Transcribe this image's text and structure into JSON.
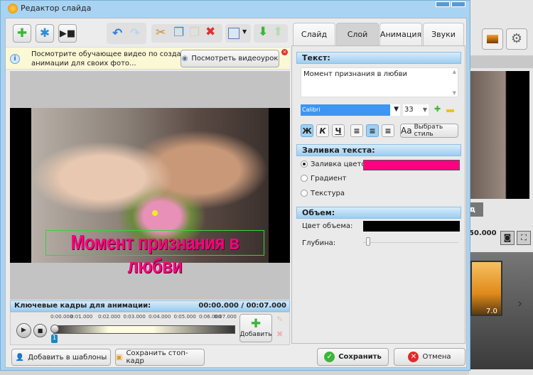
{
  "window": {
    "title": "Редактор слайда"
  },
  "info": {
    "message_line1": "Посмотрите обучающее видео по созданию",
    "message_line2": "анимации для своих фото...",
    "watch_button": "Посмотреть видеоурок"
  },
  "slide": {
    "overlay_text": "Момент признания в любви"
  },
  "keyframes": {
    "title": "Ключевые кадры для анимации:",
    "time": "00:00.000 / 00:07.000",
    "ticks": [
      "0:00.000",
      "0:01.000",
      "0:02.000",
      "0:03.000",
      "0:04.000",
      "0:05.000",
      "0:06.000",
      "0:07.000"
    ],
    "marker": "1",
    "add_label": "Добавить"
  },
  "bottom": {
    "add_template": "Добавить в шаблоны",
    "save_frame": "Сохранить стоп-кадр",
    "save": "Сохранить",
    "cancel": "Отмена"
  },
  "tabs": [
    {
      "label": "Слайд"
    },
    {
      "label": "Слой"
    },
    {
      "label": "Анимация"
    },
    {
      "label": "Звуки"
    }
  ],
  "panel": {
    "text_section": "Текст:",
    "text_value": "Момент признания в любви",
    "font": "Calibri",
    "size": "33",
    "bold": "Ж",
    "italic": "К",
    "underline": "Ч",
    "style_button": "Выбрать стиль",
    "style_prefix": "Aa",
    "fill_section": "Заливка текста:",
    "fill_color_label": "Заливка цветом",
    "gradient_label": "Градиент",
    "texture_label": "Текстура",
    "fill_color": "#ff0080",
    "volume_section": "Объем:",
    "volume_color_label": "Цвет объема:",
    "volume_color": "#000000",
    "depth_label": "Глубина:"
  },
  "background": {
    "time_readout": "50.000",
    "thumb_duration": "7.0"
  }
}
